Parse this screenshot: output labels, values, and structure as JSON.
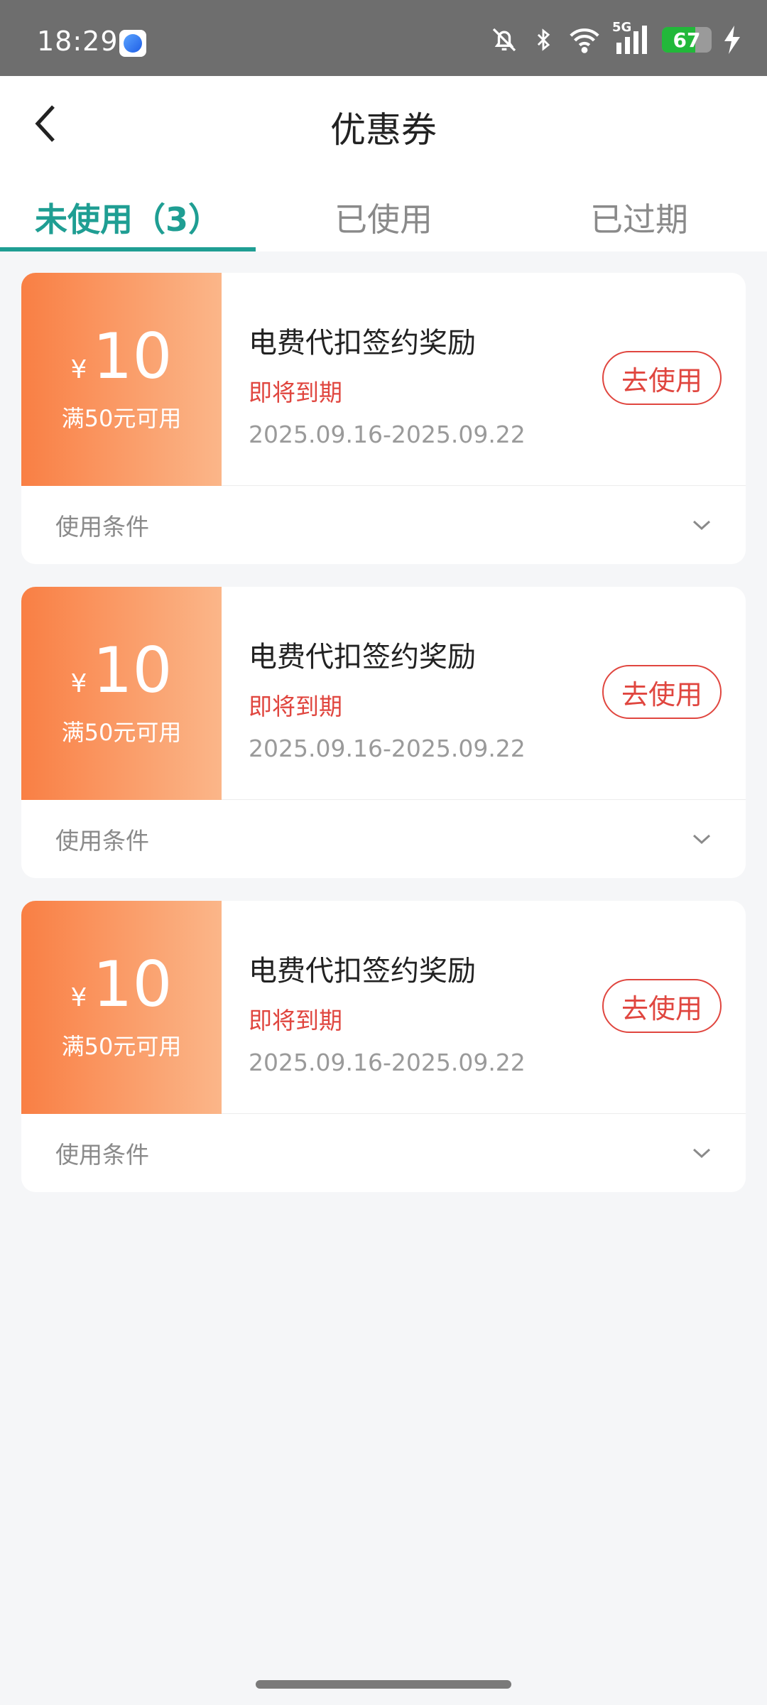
{
  "status_bar": {
    "time": "18:29",
    "battery": "67",
    "network": "5G",
    "icons": [
      "bell-off-icon",
      "bluetooth-icon",
      "wifi-icon",
      "signal-icon",
      "battery-icon",
      "charging-icon"
    ]
  },
  "header": {
    "title": "优惠券",
    "back_icon": "chevron-left-icon"
  },
  "tabs": [
    {
      "label": "未使用（3）",
      "active": true
    },
    {
      "label": "已使用",
      "active": false
    },
    {
      "label": "已过期",
      "active": false
    }
  ],
  "coupons": [
    {
      "currency": "¥",
      "amount": "10",
      "condition": "满50元可用",
      "name": "电费代扣签约奖励",
      "status": "即将到期",
      "date_range": "2025.09.16-2025.09.22",
      "button": "去使用",
      "conditions_label": "使用条件"
    },
    {
      "currency": "¥",
      "amount": "10",
      "condition": "满50元可用",
      "name": "电费代扣签约奖励",
      "status": "即将到期",
      "date_range": "2025.09.16-2025.09.22",
      "button": "去使用",
      "conditions_label": "使用条件"
    },
    {
      "currency": "¥",
      "amount": "10",
      "condition": "满50元可用",
      "name": "电费代扣签约奖励",
      "status": "即将到期",
      "date_range": "2025.09.16-2025.09.22",
      "button": "去使用",
      "conditions_label": "使用条件"
    }
  ],
  "colors": {
    "accent": "#1f9e93",
    "warning": "#e0463f",
    "coupon_gradient_start": "#f97f44",
    "coupon_gradient_end": "#fbb689"
  }
}
